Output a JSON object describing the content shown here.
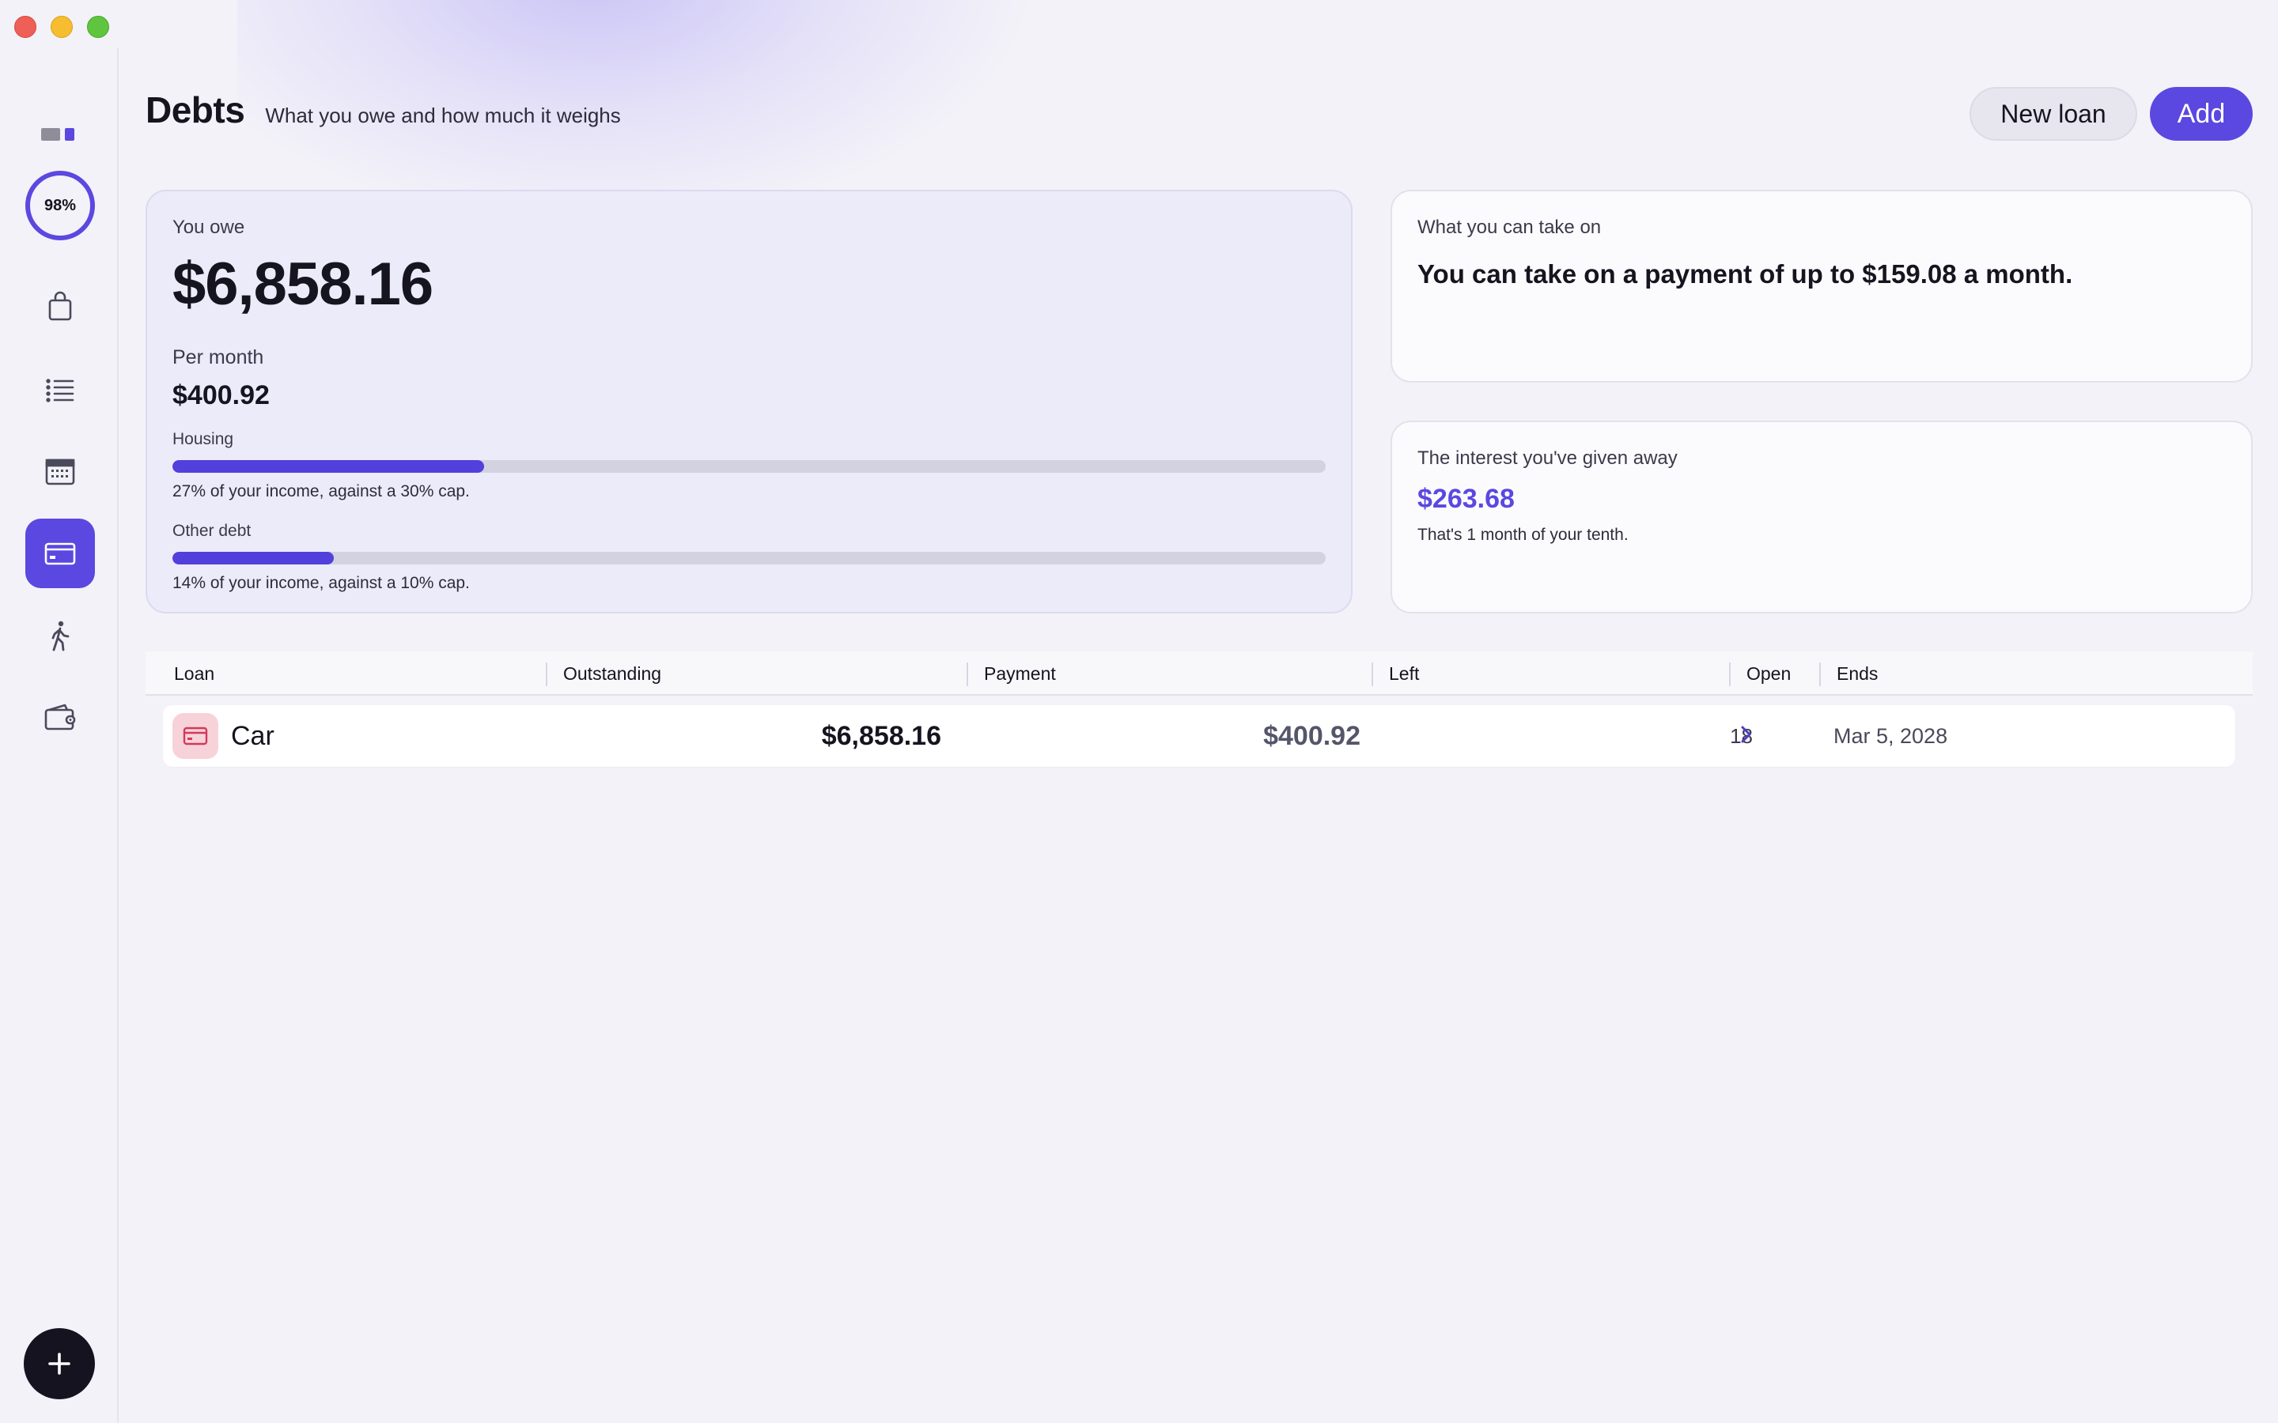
{
  "window": {
    "controls": [
      "close",
      "minimize",
      "maximize"
    ]
  },
  "sidebar": {
    "progress_label": "98%",
    "items": [
      {
        "icon": "bag-icon"
      },
      {
        "icon": "list-icon"
      },
      {
        "icon": "calendar-icon"
      },
      {
        "icon": "card-icon",
        "active": true
      },
      {
        "icon": "walking-icon"
      },
      {
        "icon": "wallet-icon"
      }
    ],
    "add_icon": "plus-icon"
  },
  "header": {
    "title": "Debts",
    "subtitle": "What you owe and how much it weighs",
    "new_loan_label": "New loan",
    "add_label": "Add"
  },
  "owe": {
    "label": "You owe",
    "amount": "$6,858.16",
    "per_month_label": "Per month",
    "per_month_value": "$400.92",
    "housing": {
      "label": "Housing",
      "fraction": 0.27,
      "note": "27% of your income, against a 30% cap."
    },
    "other": {
      "label": "Other debt",
      "fraction": 0.14,
      "note": "14% of your income, against a 10% cap."
    }
  },
  "take_on": {
    "label": "What you can take on",
    "text": "You can take on a payment of up to $159.08 a month."
  },
  "interest": {
    "label": "The interest you've given away",
    "value": "$263.68",
    "note": "That's 1 month of your tenth."
  },
  "table": {
    "headers": {
      "loan": "Loan",
      "outstanding": "Outstanding",
      "payment": "Payment",
      "left": "Left",
      "open": "Open",
      "ends": "Ends"
    },
    "rows": [
      {
        "name": "Car",
        "outstanding": "$6,858.16",
        "payment": "$400.92",
        "left": "18",
        "ends": "Mar 5, 2028"
      }
    ]
  },
  "colors": {
    "accent": "#5b48e0",
    "bar_track": "#d3d2e0",
    "car_icon_bg": "#f7d3d9",
    "car_icon": "#d23a5a"
  }
}
